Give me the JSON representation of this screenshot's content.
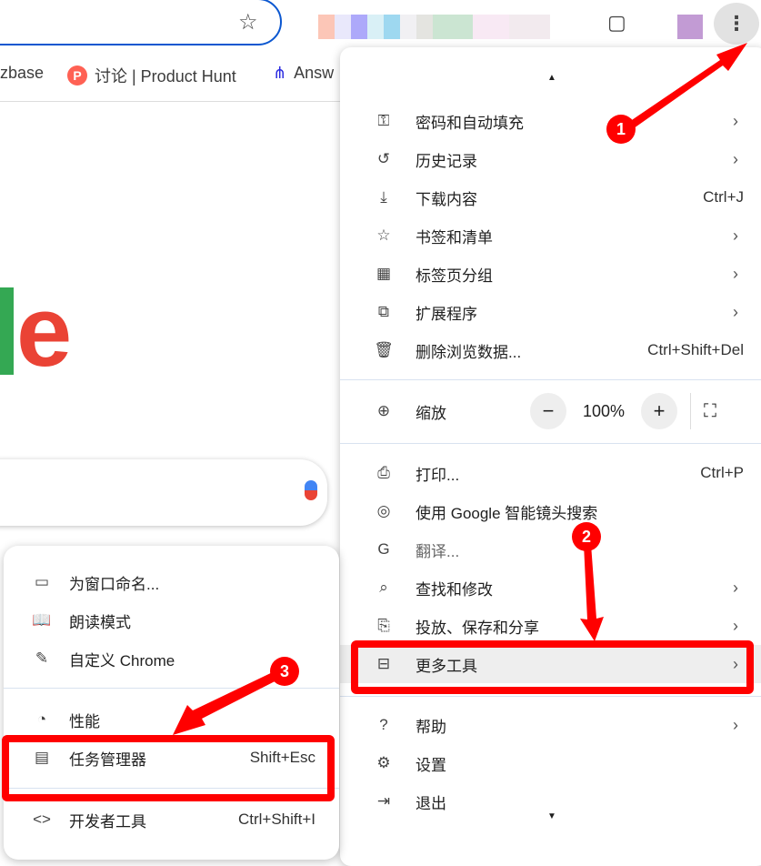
{
  "toolbar": {
    "bookmark_icon": "star-icon",
    "menu_icon": "three-dots-icon"
  },
  "bookmarks": [
    {
      "label": "zbase"
    },
    {
      "label": "讨论 | Product Hunt",
      "icon": "P"
    },
    {
      "label": "Answ"
    }
  ],
  "main_menu": {
    "items_top": [
      {
        "label": "密码和自动填充",
        "icon": "key-icon",
        "arrow": "›"
      },
      {
        "label": "历史记录",
        "icon": "history-icon",
        "arrow": "›"
      },
      {
        "label": "下载内容",
        "icon": "download-icon",
        "shortcut": "Ctrl+J"
      },
      {
        "label": "书签和清单",
        "icon": "star-icon",
        "arrow": "›"
      },
      {
        "label": "标签页分组",
        "icon": "grid-icon",
        "arrow": "›"
      },
      {
        "label": "扩展程序",
        "icon": "puzzle-icon",
        "arrow": "›"
      },
      {
        "label": "删除浏览数据...",
        "icon": "trash-icon",
        "shortcut": "Ctrl+Shift+Del"
      }
    ],
    "zoom": {
      "label": "缩放",
      "value": "100%",
      "minus": "−",
      "plus": "+"
    },
    "items_mid": [
      {
        "label": "打印...",
        "icon": "printer-icon",
        "shortcut": "Ctrl+P"
      },
      {
        "label": "使用 Google 智能镜头搜索",
        "icon": "lens-icon"
      },
      {
        "label": "翻译...",
        "icon": "translate-icon"
      },
      {
        "label": "查找和修改",
        "icon": "find-icon",
        "arrow": "›"
      },
      {
        "label": "投放、保存和分享",
        "icon": "cast-icon",
        "arrow": "›"
      },
      {
        "label": "更多工具",
        "icon": "toolbox-icon",
        "arrow": "›"
      }
    ],
    "items_bottom": [
      {
        "label": "帮助",
        "icon": "help-icon",
        "arrow": "›"
      },
      {
        "label": "设置",
        "icon": "gear-icon"
      },
      {
        "label": "退出",
        "icon": "exit-icon"
      }
    ]
  },
  "sub_menu": {
    "items": [
      {
        "label": "为窗口命名...",
        "icon": "window-icon"
      },
      {
        "label": "朗读模式",
        "icon": "book-icon"
      },
      {
        "label": "自定义 Chrome",
        "icon": "pencil-icon"
      },
      {
        "label": "性能",
        "icon": "gauge-icon"
      },
      {
        "label": "任务管理器",
        "icon": "table-icon",
        "shortcut": "Shift+Esc"
      },
      {
        "label": "开发者工具",
        "icon": "code-icon",
        "shortcut": "Ctrl+Shift+I"
      }
    ]
  },
  "annotations": {
    "step1": "1",
    "step2": "2",
    "step3": "3",
    "color": "#ff0000"
  }
}
